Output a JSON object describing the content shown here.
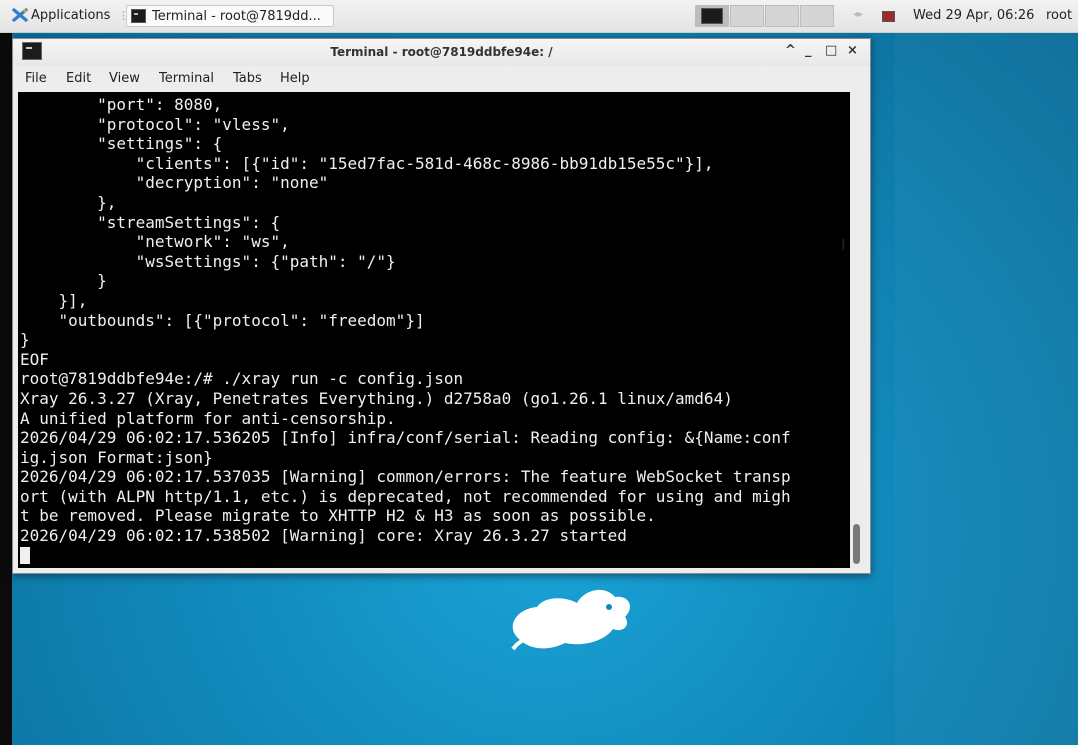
{
  "panel": {
    "applications_label": "Applications",
    "task_title": "Terminal - root@7819dd...",
    "clock": "Wed 29 Apr, 06:26",
    "user": "root"
  },
  "window": {
    "title": "Terminal - root@7819ddbfe94e: /",
    "controls": {
      "shade": "^",
      "minimize": "_",
      "maximize": "□",
      "close": "×"
    }
  },
  "menu": [
    "File",
    "Edit",
    "View",
    "Terminal",
    "Tabs",
    "Help"
  ],
  "terminal_lines": [
    "        \"port\": 8080,",
    "        \"protocol\": \"vless\",",
    "        \"settings\": {",
    "            \"clients\": [{\"id\": \"15ed7fac-581d-468c-8986-bb91db15e55c\"}],",
    "            \"decryption\": \"none\"",
    "        },",
    "        \"streamSettings\": {",
    "            \"network\": \"ws\",",
    "            \"wsSettings\": {\"path\": \"/\"}",
    "        }",
    "    }],",
    "    \"outbounds\": [{\"protocol\": \"freedom\"}]",
    "}",
    "EOF",
    "root@7819ddbfe94e:/# ./xray run -c config.json",
    "Xray 26.3.27 (Xray, Penetrates Everything.) d2758a0 (go1.26.1 linux/amd64)",
    "A unified platform for anti-censorship.",
    "2026/04/29 06:02:17.536205 [Info] infra/conf/serial: Reading config: &{Name:conf",
    "ig.json Format:json}",
    "2026/04/29 06:02:17.537035 [Warning] common/errors: The feature WebSocket transp",
    "ort (with ALPN http/1.1, etc.) is deprecated, not recommended for using and migh",
    "t be removed. Please migrate to XHTTP H2 & H3 as soon as possible.",
    "2026/04/29 06:02:17.538502 [Warning] core: Xray 26.3.27 started"
  ]
}
